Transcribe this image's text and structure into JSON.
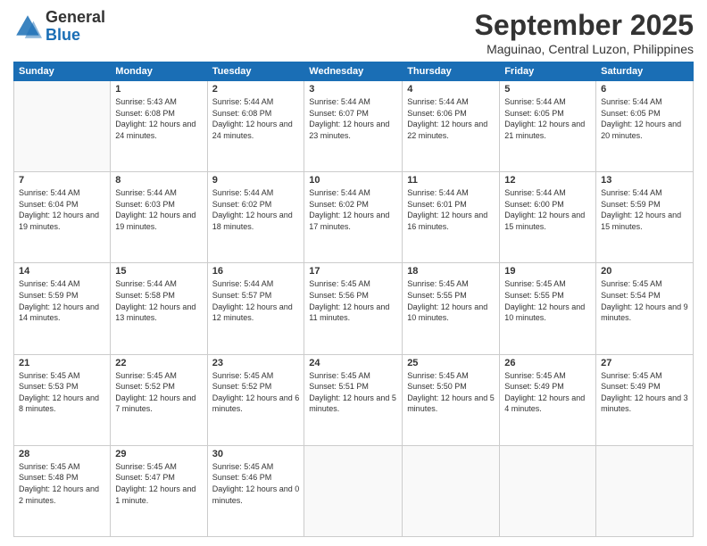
{
  "header": {
    "logo_general": "General",
    "logo_blue": "Blue",
    "month_title": "September 2025",
    "subtitle": "Maguinao, Central Luzon, Philippines"
  },
  "weekdays": [
    "Sunday",
    "Monday",
    "Tuesday",
    "Wednesday",
    "Thursday",
    "Friday",
    "Saturday"
  ],
  "weeks": [
    [
      {
        "num": "",
        "info": ""
      },
      {
        "num": "1",
        "info": "Sunrise: 5:43 AM\nSunset: 6:08 PM\nDaylight: 12 hours\nand 24 minutes."
      },
      {
        "num": "2",
        "info": "Sunrise: 5:44 AM\nSunset: 6:08 PM\nDaylight: 12 hours\nand 24 minutes."
      },
      {
        "num": "3",
        "info": "Sunrise: 5:44 AM\nSunset: 6:07 PM\nDaylight: 12 hours\nand 23 minutes."
      },
      {
        "num": "4",
        "info": "Sunrise: 5:44 AM\nSunset: 6:06 PM\nDaylight: 12 hours\nand 22 minutes."
      },
      {
        "num": "5",
        "info": "Sunrise: 5:44 AM\nSunset: 6:05 PM\nDaylight: 12 hours\nand 21 minutes."
      },
      {
        "num": "6",
        "info": "Sunrise: 5:44 AM\nSunset: 6:05 PM\nDaylight: 12 hours\nand 20 minutes."
      }
    ],
    [
      {
        "num": "7",
        "info": "Sunrise: 5:44 AM\nSunset: 6:04 PM\nDaylight: 12 hours\nand 19 minutes."
      },
      {
        "num": "8",
        "info": "Sunrise: 5:44 AM\nSunset: 6:03 PM\nDaylight: 12 hours\nand 19 minutes."
      },
      {
        "num": "9",
        "info": "Sunrise: 5:44 AM\nSunset: 6:02 PM\nDaylight: 12 hours\nand 18 minutes."
      },
      {
        "num": "10",
        "info": "Sunrise: 5:44 AM\nSunset: 6:02 PM\nDaylight: 12 hours\nand 17 minutes."
      },
      {
        "num": "11",
        "info": "Sunrise: 5:44 AM\nSunset: 6:01 PM\nDaylight: 12 hours\nand 16 minutes."
      },
      {
        "num": "12",
        "info": "Sunrise: 5:44 AM\nSunset: 6:00 PM\nDaylight: 12 hours\nand 15 minutes."
      },
      {
        "num": "13",
        "info": "Sunrise: 5:44 AM\nSunset: 5:59 PM\nDaylight: 12 hours\nand 15 minutes."
      }
    ],
    [
      {
        "num": "14",
        "info": "Sunrise: 5:44 AM\nSunset: 5:59 PM\nDaylight: 12 hours\nand 14 minutes."
      },
      {
        "num": "15",
        "info": "Sunrise: 5:44 AM\nSunset: 5:58 PM\nDaylight: 12 hours\nand 13 minutes."
      },
      {
        "num": "16",
        "info": "Sunrise: 5:44 AM\nSunset: 5:57 PM\nDaylight: 12 hours\nand 12 minutes."
      },
      {
        "num": "17",
        "info": "Sunrise: 5:45 AM\nSunset: 5:56 PM\nDaylight: 12 hours\nand 11 minutes."
      },
      {
        "num": "18",
        "info": "Sunrise: 5:45 AM\nSunset: 5:55 PM\nDaylight: 12 hours\nand 10 minutes."
      },
      {
        "num": "19",
        "info": "Sunrise: 5:45 AM\nSunset: 5:55 PM\nDaylight: 12 hours\nand 10 minutes."
      },
      {
        "num": "20",
        "info": "Sunrise: 5:45 AM\nSunset: 5:54 PM\nDaylight: 12 hours\nand 9 minutes."
      }
    ],
    [
      {
        "num": "21",
        "info": "Sunrise: 5:45 AM\nSunset: 5:53 PM\nDaylight: 12 hours\nand 8 minutes."
      },
      {
        "num": "22",
        "info": "Sunrise: 5:45 AM\nSunset: 5:52 PM\nDaylight: 12 hours\nand 7 minutes."
      },
      {
        "num": "23",
        "info": "Sunrise: 5:45 AM\nSunset: 5:52 PM\nDaylight: 12 hours\nand 6 minutes."
      },
      {
        "num": "24",
        "info": "Sunrise: 5:45 AM\nSunset: 5:51 PM\nDaylight: 12 hours\nand 5 minutes."
      },
      {
        "num": "25",
        "info": "Sunrise: 5:45 AM\nSunset: 5:50 PM\nDaylight: 12 hours\nand 5 minutes."
      },
      {
        "num": "26",
        "info": "Sunrise: 5:45 AM\nSunset: 5:49 PM\nDaylight: 12 hours\nand 4 minutes."
      },
      {
        "num": "27",
        "info": "Sunrise: 5:45 AM\nSunset: 5:49 PM\nDaylight: 12 hours\nand 3 minutes."
      }
    ],
    [
      {
        "num": "28",
        "info": "Sunrise: 5:45 AM\nSunset: 5:48 PM\nDaylight: 12 hours\nand 2 minutes."
      },
      {
        "num": "29",
        "info": "Sunrise: 5:45 AM\nSunset: 5:47 PM\nDaylight: 12 hours\nand 1 minute."
      },
      {
        "num": "30",
        "info": "Sunrise: 5:45 AM\nSunset: 5:46 PM\nDaylight: 12 hours\nand 0 minutes."
      },
      {
        "num": "",
        "info": ""
      },
      {
        "num": "",
        "info": ""
      },
      {
        "num": "",
        "info": ""
      },
      {
        "num": "",
        "info": ""
      }
    ]
  ]
}
